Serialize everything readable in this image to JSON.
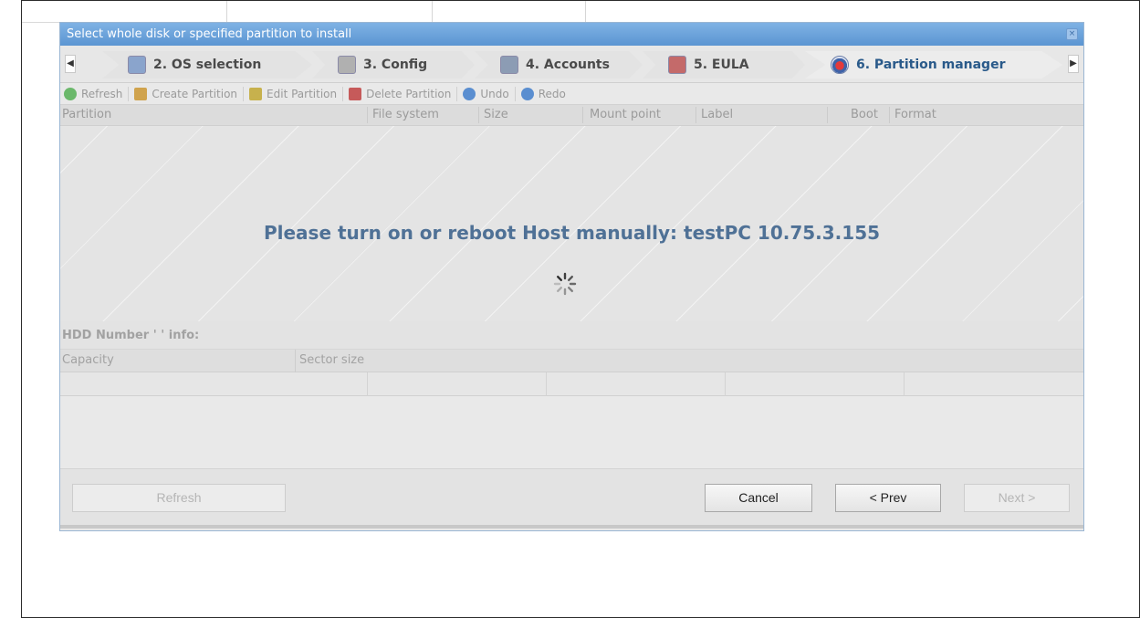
{
  "dialog": {
    "title": "Select whole disk or specified partition to install",
    "close_label": "×"
  },
  "steps": {
    "prev_arrow": "◀",
    "next_arrow": "▶",
    "items": [
      {
        "label": "2. OS selection",
        "icon": "os-selection-icon"
      },
      {
        "label": "3. Config",
        "icon": "config-icon"
      },
      {
        "label": "4. Accounts",
        "icon": "accounts-icon"
      },
      {
        "label": "5. EULA",
        "icon": "eula-icon"
      },
      {
        "label": "6. Partition manager",
        "icon": "partition-manager-icon",
        "active": true
      }
    ]
  },
  "toolbar": {
    "refresh": "Refresh",
    "create": "Create Partition",
    "edit": "Edit Partition",
    "delete": "Delete Partition",
    "undo": "Undo",
    "redo": "Redo"
  },
  "grid": {
    "columns": [
      "Partition",
      "File system",
      "Size",
      "Mount point",
      "Label",
      "Boot",
      "Format"
    ],
    "message": "Please turn on or reboot Host manually: testPC 10.75.3.155"
  },
  "hdd": {
    "title": "HDD Number '   ' info:",
    "columns": [
      "Capacity",
      "Sector size"
    ]
  },
  "footer": {
    "refresh": "Refresh",
    "cancel": "Cancel",
    "prev": "< Prev",
    "next": "Next >"
  },
  "colors": {
    "title_bar": "#5b95d2",
    "message": "#4f7196",
    "active_step": "#2a5a8a"
  }
}
